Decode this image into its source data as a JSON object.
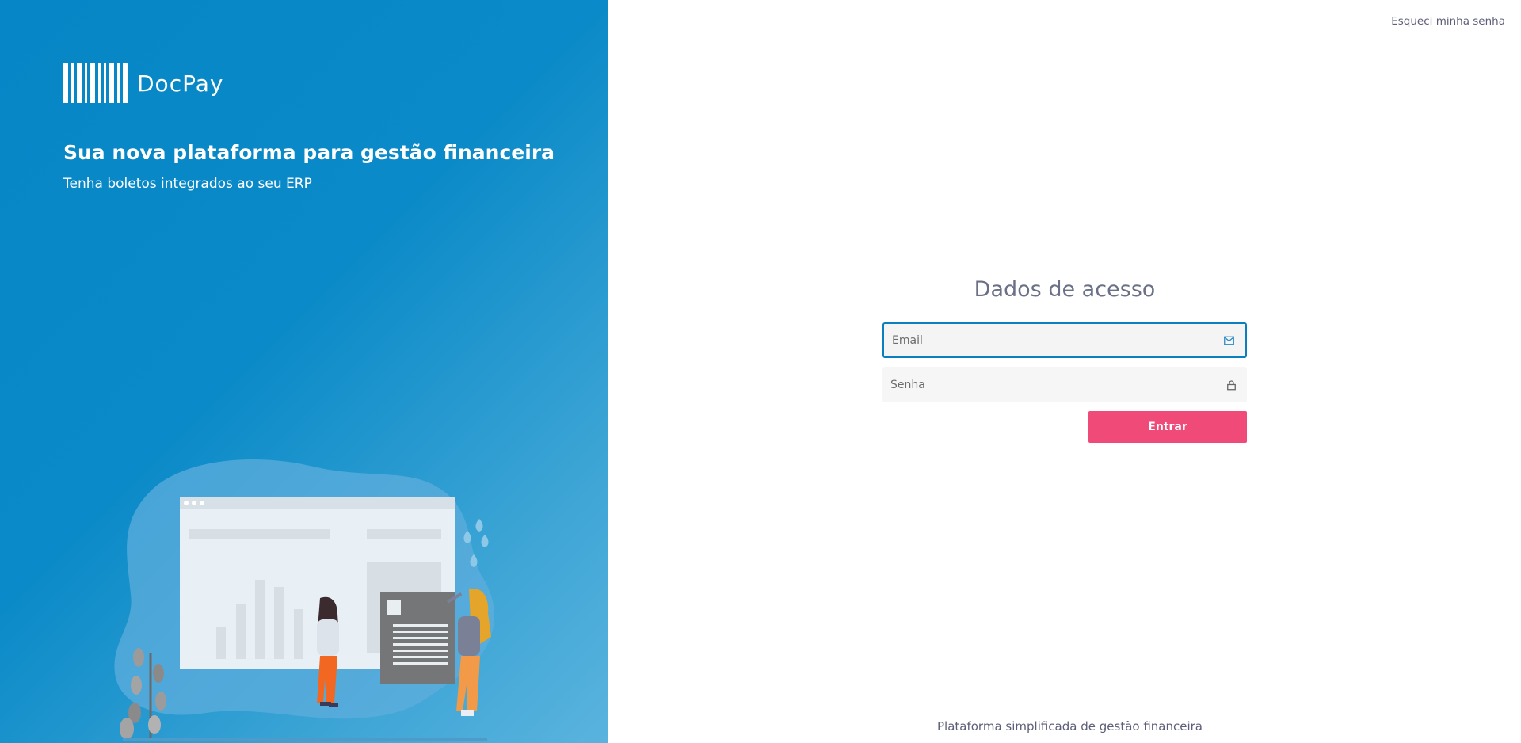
{
  "brand": {
    "name": "DocPay"
  },
  "hero": {
    "headline": "Sua nova plataforma para gestão financeira",
    "subline": "Tenha boletos integrados ao seu ERP"
  },
  "header": {
    "forgot_password": "Esqueci minha senha"
  },
  "login": {
    "title": "Dados de acesso",
    "email_placeholder": "Email",
    "password_placeholder": "Senha",
    "submit_label": "Entrar"
  },
  "footer": {
    "tagline": "Plataforma simplificada de gestão financeira"
  },
  "colors": {
    "panel_blue": "#0686c6",
    "accent_pink": "#ef4a78",
    "focus_blue": "#0a7fc0",
    "text_gray": "#5c5f77"
  },
  "icons": {
    "email": "mail-icon",
    "password": "lock-icon"
  }
}
